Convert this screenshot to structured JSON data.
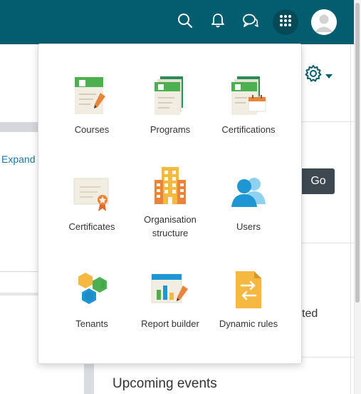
{
  "navbar": {
    "icons": [
      "search-icon",
      "bell-icon",
      "messages-icon",
      "apps-grid-icon",
      "user-avatar"
    ],
    "accent": "#035d6f"
  },
  "background": {
    "expand_link": "Expand",
    "go_button": "Go",
    "partial_text": "ted",
    "upcoming_events": "Upcoming events"
  },
  "menu": {
    "items": [
      {
        "label": "Courses",
        "icon": "courses-icon"
      },
      {
        "label": "Programs",
        "icon": "programs-icon"
      },
      {
        "label": "Certifications",
        "icon": "certifications-icon"
      },
      {
        "label": "Certificates",
        "icon": "certificates-icon"
      },
      {
        "label": "Organisation\nstructure",
        "icon": "organisation-structure-icon"
      },
      {
        "label": "Users",
        "icon": "users-icon"
      },
      {
        "label": "Tenants",
        "icon": "tenants-icon"
      },
      {
        "label": "Report builder",
        "icon": "report-builder-icon"
      },
      {
        "label": "Dynamic rules",
        "icon": "dynamic-rules-icon"
      }
    ]
  }
}
